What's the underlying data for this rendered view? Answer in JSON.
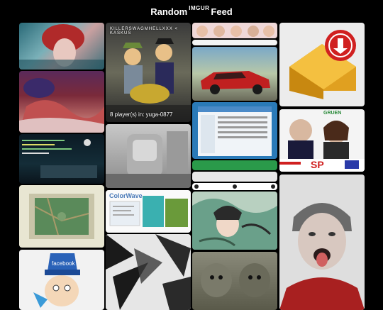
{
  "header": {
    "title_left": "Random",
    "title_sup": "IMGUR",
    "title_right": "Feed"
  },
  "tiles": {
    "game": {
      "top_caption": "KILLERSWAGMHELLXXX < KASKUS",
      "caption": "8 player(s) in: yuga-0877"
    },
    "colorwave": {
      "logo": "ColorWave"
    },
    "political": {
      "banner": "SP",
      "top_text": "GRUEN"
    }
  },
  "icons": [
    "floppy-drive-icon"
  ]
}
